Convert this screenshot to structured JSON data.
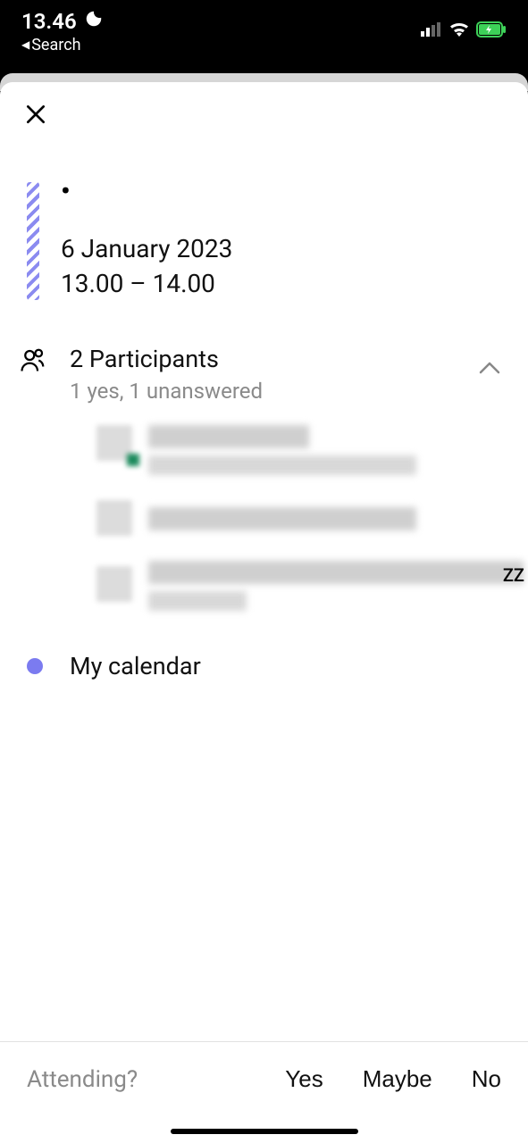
{
  "status": {
    "time": "13.46",
    "back_label": "Search"
  },
  "event": {
    "title": "•",
    "date": "6 January 2023",
    "time": "13.00 – 14.00"
  },
  "participants": {
    "title": "2 Participants",
    "status": "1 yes, 1 unanswered",
    "zz": "ZZ"
  },
  "calendar": {
    "label": "My calendar"
  },
  "rsvp": {
    "label": "Attending?",
    "yes": "Yes",
    "maybe": "Maybe",
    "no": "No"
  }
}
